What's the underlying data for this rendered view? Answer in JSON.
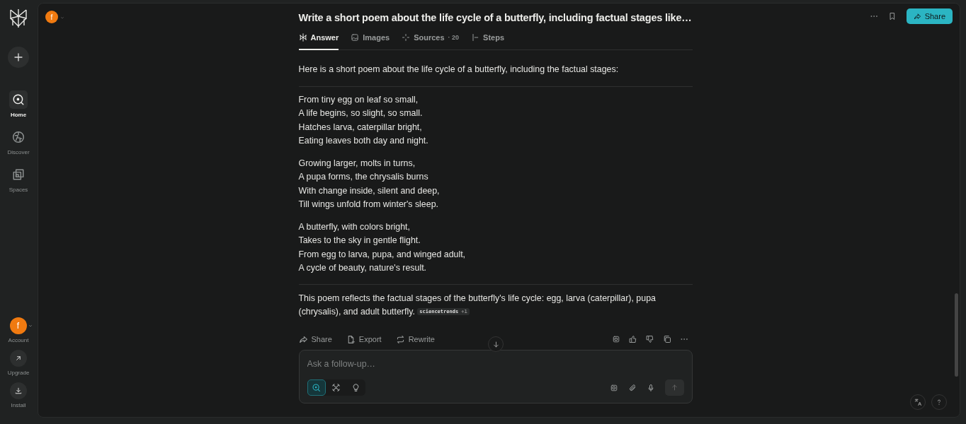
{
  "sidebar": {
    "new_button": {
      "kind": "plus"
    },
    "nav": [
      {
        "label": "Home",
        "kind": "home",
        "selected": true
      },
      {
        "label": "Discover",
        "kind": "discover",
        "selected": false
      },
      {
        "label": "Spaces",
        "kind": "spaces",
        "selected": false
      }
    ],
    "account": {
      "avatar": "f",
      "label": "Account"
    },
    "bottom": [
      {
        "label": "Upgrade",
        "kind": "upgrade"
      },
      {
        "label": "Install",
        "kind": "install"
      }
    ]
  },
  "header": {
    "avatar": "f",
    "title": "Write a short poem about the life cycle of a butterfly, including factual stages like…",
    "share": "Share"
  },
  "tabs": [
    {
      "label": "Answer",
      "kind": "answer",
      "selected": true
    },
    {
      "label": "Images",
      "kind": "images",
      "selected": false
    },
    {
      "label": "Sources",
      "count": "· 20",
      "kind": "sources",
      "selected": false
    },
    {
      "label": "Steps",
      "kind": "steps",
      "selected": false
    }
  ],
  "answer": {
    "intro": "Here is a short poem about the life cycle of a butterfly, including the factual stages:",
    "stanzas": [
      [
        "From tiny egg on leaf so small,",
        "A life begins, so slight, so small.",
        "Hatches larva, caterpillar bright,",
        "Eating leaves both day and night."
      ],
      [
        "Growing larger, molts in turns,",
        "A pupa forms, the chrysalis burns",
        "With change inside, silent and deep,",
        "Till wings unfold from winter's sleep."
      ],
      [
        "A butterfly, with colors bright,",
        "Takes to the sky in gentle flight.",
        "From egg to larva, pupa, and winged adult,",
        "A cycle of beauty, nature's result."
      ]
    ],
    "summary": "This poem reflects the factual stages of the butterfly's life cycle: egg, larva (caterpillar), pupa (chrysalis), and adult butterfly.",
    "citation": {
      "source": "sciencetrends",
      "extra": "+1"
    }
  },
  "actions": [
    {
      "label": "Share",
      "kind": "share"
    },
    {
      "label": "Export",
      "kind": "export"
    },
    {
      "label": "Rewrite",
      "kind": "rewrite"
    }
  ],
  "followup": {
    "placeholder": "Ask a follow-up…",
    "modes": [
      {
        "kind": "search",
        "selected": true
      },
      {
        "kind": "reason",
        "selected": false
      },
      {
        "kind": "idea",
        "selected": false
      }
    ]
  }
}
